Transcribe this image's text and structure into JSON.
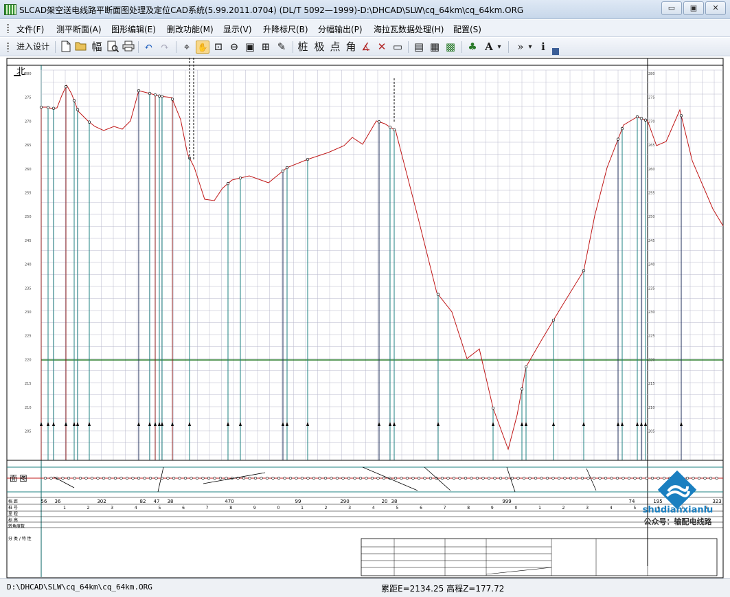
{
  "window": {
    "title": "SLCAD架空送电线路平断面图处理及定位CAD系统(5.99.2011.0704) (DL/T 5092—1999)-D:\\DHCAD\\SLW\\cq_64km\\cq_64km.ORG",
    "minimize": "▭",
    "restore": "▣",
    "close": "✕"
  },
  "menu": [
    {
      "label": "文件(F)"
    },
    {
      "label": "测平断面(A)"
    },
    {
      "label": "图形编辑(E)"
    },
    {
      "label": "删改功能(M)"
    },
    {
      "label": "显示(V)"
    },
    {
      "label": "升降标尺(B)"
    },
    {
      "label": "分幅输出(P)"
    },
    {
      "label": "海拉瓦数据处理(H)"
    },
    {
      "label": "配置(S)"
    }
  ],
  "toolbar": {
    "enter_design": "进入设计",
    "new_icon": "new-file-icon",
    "open_icon": "open-folder-icon",
    "sheet": "幅",
    "preview_icon": "print-preview-icon",
    "print_icon": "printer-icon",
    "undo": "↶",
    "redo": "↷",
    "crosshair": "⌖",
    "hand": "✋",
    "zoom_window": "⊡",
    "zoom_out": "⊖",
    "zoom_fit": "▣",
    "zoom_all": "⊞",
    "text_edit": "✎",
    "pile": "桩",
    "pole": "极",
    "point": "点",
    "angle": "角",
    "measure": "∡",
    "cross": "✕",
    "ruler": "▭",
    "export1": "▤",
    "export2": "▦",
    "chart": "▩",
    "tree": "♣",
    "font": "A",
    "font_drop": "▾",
    "more": "»",
    "more_drop": "▾",
    "info": "i"
  },
  "colors": {
    "profile_line": "#c01818",
    "grid": "#b8b8cc",
    "teal": "#1e8080",
    "ground_line": "#006400",
    "tower_red": "#8b1a1a",
    "watermark_blue": "#1a7fc0"
  },
  "drawing": {
    "north_label": "北",
    "plan_label": "面  图",
    "row_labels": [
      "档 距",
      "桩  号",
      "里  程",
      "标  高",
      "转角度数",
      "",
      "分  类 / 特 性"
    ],
    "span_values": [
      "56",
      "36",
      "302",
      "82",
      "47",
      "38",
      "470",
      "99",
      "290",
      "20",
      "38",
      "999",
      "74",
      "195",
      "323"
    ],
    "km_marks": [
      "1",
      "2",
      "3",
      "4",
      "5",
      "6",
      "7",
      "8",
      "9",
      "0",
      "1",
      "2",
      "3",
      "4",
      "5",
      "6",
      "7",
      "8",
      "9",
      "0",
      "1",
      "2",
      "3",
      "4",
      "5",
      "6",
      "7",
      "8",
      "9"
    ],
    "y_axis": [
      "280",
      "275",
      "270",
      "265",
      "260",
      "255",
      "250",
      "245",
      "240",
      "235",
      "230",
      "225",
      "220",
      "215",
      "210",
      "205"
    ]
  },
  "status": {
    "path": "D:\\DHCAD\\SLW\\cq_64km\\cq_64km.ORG",
    "coords": "累距E=2134.25 高程Z=177.72"
  },
  "watermark": {
    "brand": "shudianxianlu",
    "public_account": "公众号：输配电线路"
  }
}
